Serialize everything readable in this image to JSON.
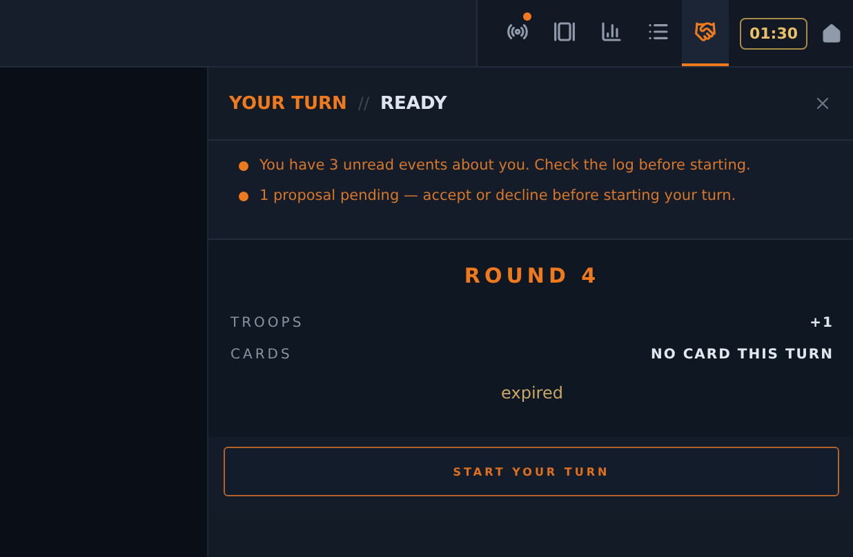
{
  "toolbar": {
    "items": [
      {
        "kind": "signal",
        "selected": false,
        "badge": true
      },
      {
        "kind": "cards",
        "selected": false,
        "badge": false
      },
      {
        "kind": "chart",
        "selected": false,
        "badge": false
      },
      {
        "kind": "list",
        "selected": false,
        "badge": false
      },
      {
        "kind": "handshake",
        "selected": true,
        "badge": false
      }
    ],
    "timer": "01:30"
  },
  "panel": {
    "title": "YOUR TURN",
    "separator": "//",
    "status": "READY",
    "notices": [
      "You have 3 unread events about you. Check the log before starting.",
      "1 proposal pending — accept or decline before starting your turn."
    ],
    "round": "ROUND 4",
    "stats": [
      {
        "label": "TROOPS",
        "value": "+1"
      },
      {
        "label": "CARDS",
        "value": "NO CARD THIS TURN"
      }
    ],
    "note": "expired",
    "button": "START YOUR TURN"
  }
}
